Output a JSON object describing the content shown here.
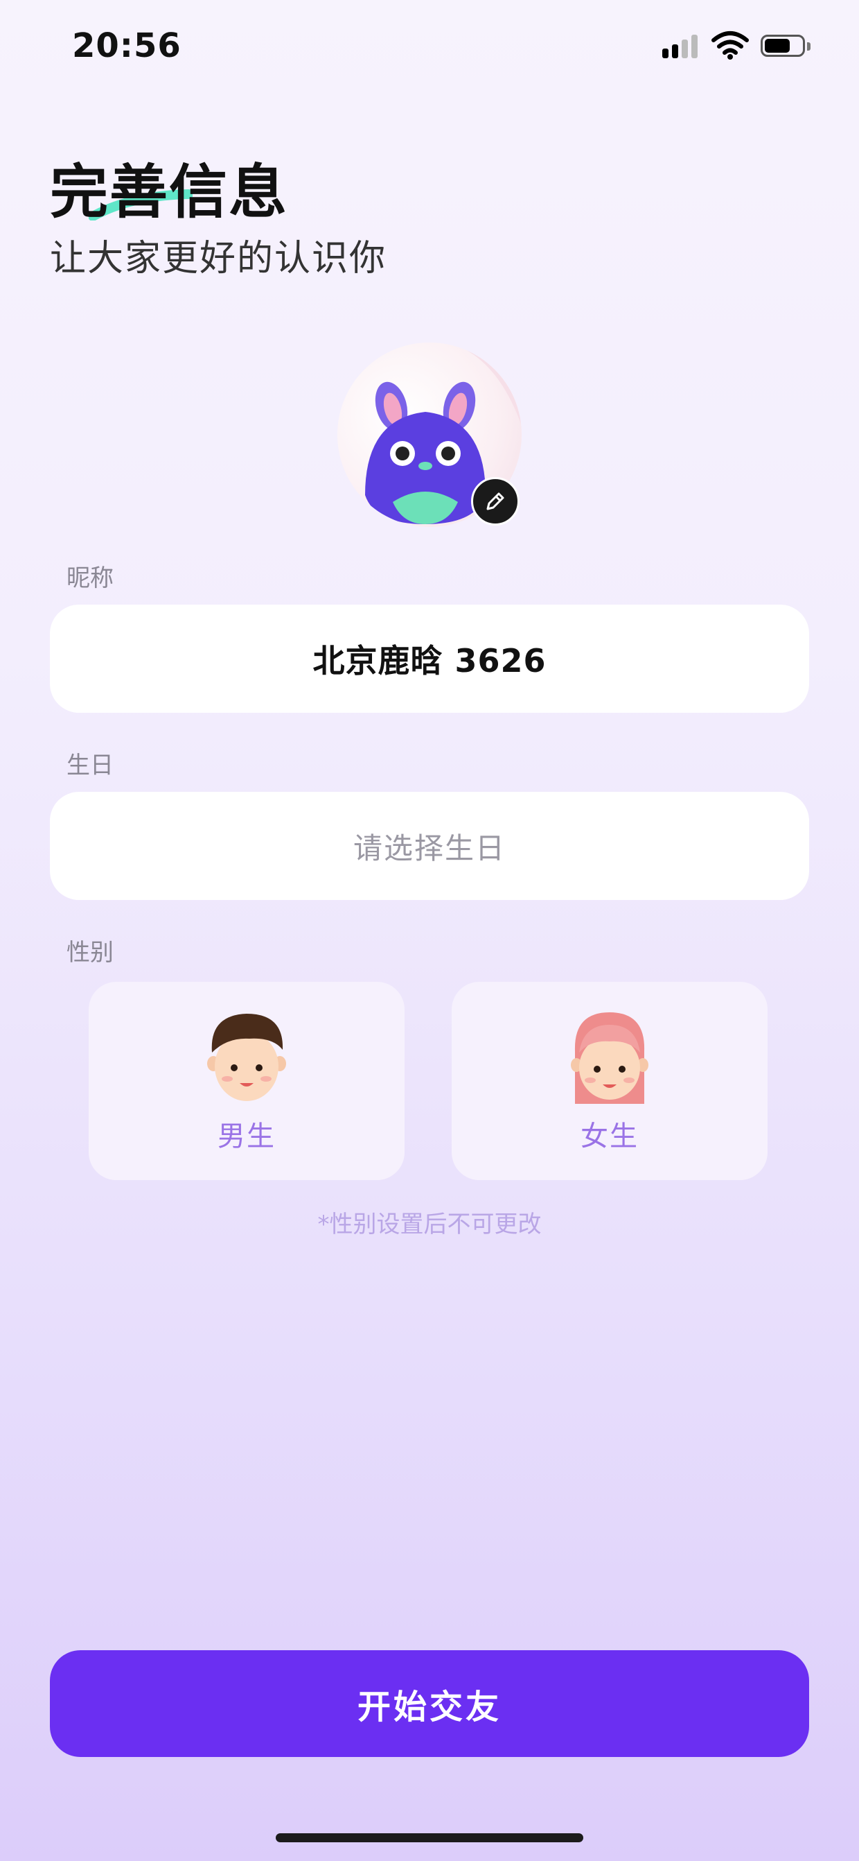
{
  "status_bar": {
    "time": "20:56",
    "battery_level": 0.7
  },
  "header": {
    "title": "完善信息",
    "subtitle": "让大家更好的认识你",
    "accent_color": "#5fe6c8"
  },
  "avatar": {
    "icon": "mascot-avatar",
    "edit_icon": "pencil-icon"
  },
  "form": {
    "nickname_label": "昵称",
    "nickname_value": "北京鹿晗 3626",
    "birthday_label": "生日",
    "birthday_placeholder": "请选择生日",
    "gender_label": "性别",
    "gender_options": [
      {
        "label": "男生",
        "icon": "boy-avatar-icon"
      },
      {
        "label": "女生",
        "icon": "girl-avatar-icon"
      }
    ],
    "gender_note": "*性别设置后不可更改"
  },
  "actions": {
    "start_label": "开始交友",
    "start_color": "#6b2ff2"
  }
}
